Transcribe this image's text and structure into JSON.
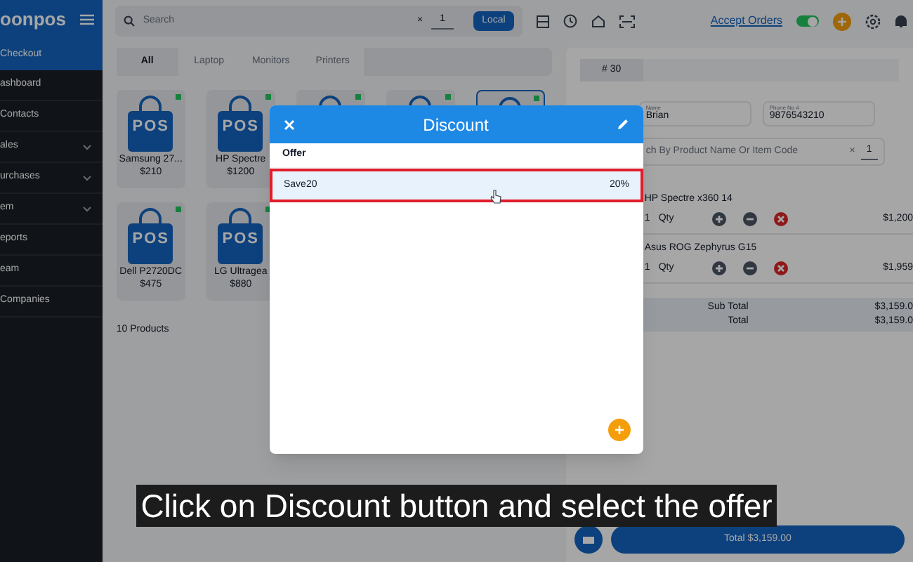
{
  "sidebar": {
    "logo": "oonpos",
    "items": [
      {
        "label": "Checkout",
        "selected": true,
        "expandable": false
      },
      {
        "label": "ashboard",
        "selected": false,
        "expandable": false
      },
      {
        "label": "Contacts",
        "selected": false,
        "expandable": false
      },
      {
        "label": "ales",
        "selected": false,
        "expandable": true
      },
      {
        "label": "urchases",
        "selected": false,
        "expandable": true
      },
      {
        "label": "em",
        "selected": false,
        "expandable": true
      },
      {
        "label": "eports",
        "selected": false,
        "expandable": false
      },
      {
        "label": "eam",
        "selected": false,
        "expandable": false
      },
      {
        "label": "Companies",
        "selected": false,
        "expandable": false
      }
    ]
  },
  "topbar": {
    "search": {
      "placeholder": "Search",
      "clear": "×",
      "quantity": "1"
    },
    "location_button": "Local",
    "accept_orders": {
      "label": "Accept Orders",
      "on": true
    }
  },
  "categories": [
    {
      "label": "All",
      "selected": true
    },
    {
      "label": "Laptop",
      "selected": false
    },
    {
      "label": "Monitors",
      "selected": false
    },
    {
      "label": "Printers",
      "selected": false
    }
  ],
  "products": [
    {
      "logo": "POS",
      "name": "Samsung 27...",
      "price": "$210",
      "selected": false
    },
    {
      "logo": "POS",
      "name": "HP Spectre",
      "price": "$1200",
      "selected": false
    },
    {
      "selected": false
    },
    {
      "selected": false
    },
    {
      "selected": true
    },
    {
      "logo": "POS",
      "name": "Dell P2720DC",
      "price": "$475",
      "selected": false
    },
    {
      "logo": "POS",
      "name": "LG Ultragea",
      "price": "$880",
      "selected": false
    }
  ],
  "product_count": "10 Products",
  "order": {
    "number": "# 30",
    "customer": {
      "name_label": "Name",
      "name": "Brian",
      "phone_label": "Phone No #",
      "phone": "9876543210"
    },
    "item_search": {
      "placeholder": "ch By Product Name Or Item Code",
      "clear": "×",
      "quantity": "1"
    },
    "items": [
      {
        "name": "HP Spectre x360 14",
        "quantity": "1",
        "qty_label": "Qty",
        "price": "$1,200"
      },
      {
        "name": "Asus ROG Zephyrus G15",
        "quantity": "1",
        "qty_label": "Qty",
        "price": "$1,959"
      }
    ],
    "totals": [
      {
        "label": "Sub Total",
        "value": "$3,159.0"
      },
      {
        "label": "Total",
        "value": "$3,159.0"
      }
    ],
    "pay_button": "Total $3,159.00"
  },
  "dialog": {
    "title": "Discount",
    "column": "Offer",
    "offers": [
      {
        "name": "Save20",
        "value": "20%",
        "selected": true
      }
    ]
  },
  "caption": "Click on Discount button and select the offer"
}
